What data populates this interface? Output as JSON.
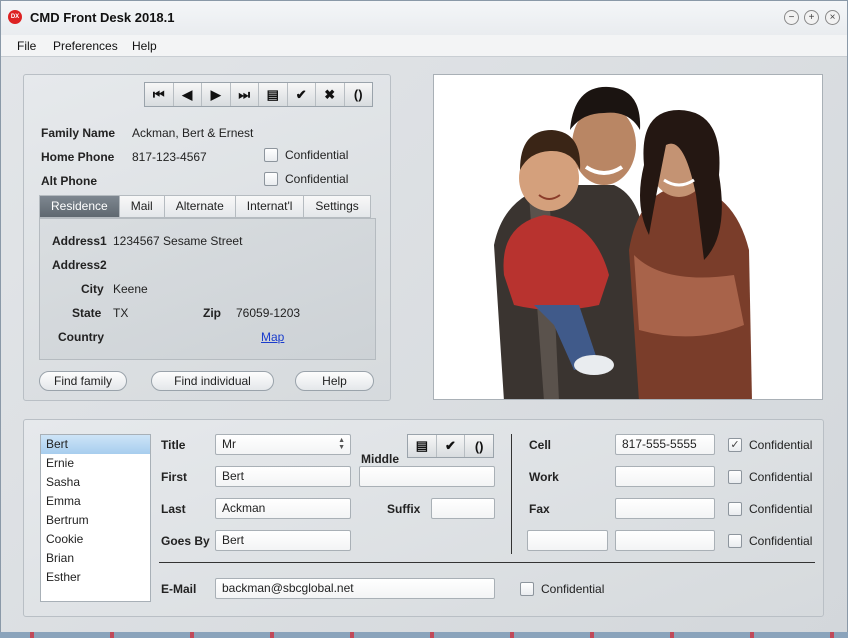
{
  "window": {
    "title": "CMD Front Desk 2018.1",
    "icon_text": "DX"
  },
  "menu": [
    "File",
    "Preferences",
    "Help"
  ],
  "family": {
    "labels": {
      "family_name": "Family Name",
      "home_phone": "Home Phone",
      "alt_phone": "Alt Phone"
    },
    "family_name": "Ackman, Bert & Ernest",
    "home_phone": "817-123-4567",
    "alt_phone": "",
    "confidential_label": "Confidential"
  },
  "tabs": [
    "Residence",
    "Mail",
    "Alternate",
    "Internat'l",
    "Settings"
  ],
  "address": {
    "labels": {
      "address1": "Address1",
      "address2": "Address2",
      "city": "City",
      "state": "State",
      "zip": "Zip",
      "country": "Country"
    },
    "address1": "1234567 Sesame Street",
    "address2": "",
    "city": "Keene",
    "state": "TX",
    "zip": "76059-1203",
    "country": "",
    "map_link": "Map"
  },
  "buttons": {
    "find_family": "Find family",
    "find_individual": "Find individual",
    "help": "Help"
  },
  "members": [
    "Bert",
    "Ernie",
    "Sasha",
    "Emma",
    "Bertrum",
    "Cookie",
    "Brian",
    "Esther"
  ],
  "person": {
    "labels": {
      "title": "Title",
      "first": "First",
      "middle": "Middle",
      "last": "Last",
      "suffix": "Suffix",
      "goes_by": "Goes By",
      "email": "E-Mail",
      "cell": "Cell",
      "work": "Work",
      "fax": "Fax"
    },
    "title": "Mr",
    "first": "Bert",
    "middle": "",
    "last": "Ackman",
    "suffix": "",
    "goes_by": "Bert",
    "email": "backman@sbcglobal.net",
    "cell": "817-555-5555",
    "work": "",
    "fax": "",
    "confidential_label": "Confidential"
  },
  "icons": {
    "first": "⏮",
    "prev": "◀",
    "next": "▶",
    "last": "⏭",
    "doc": "▤",
    "check": "✔",
    "cancel": "✖",
    "refresh": "()",
    "checkmark": "✓"
  }
}
